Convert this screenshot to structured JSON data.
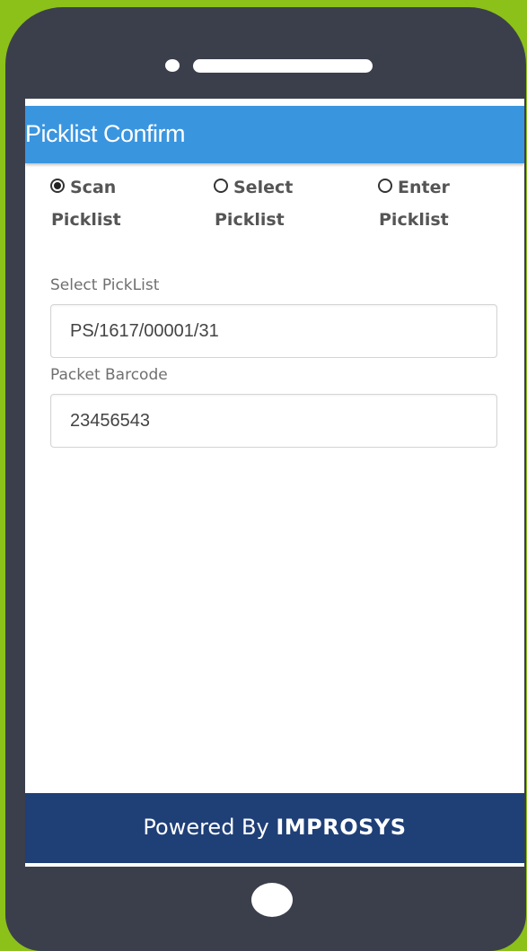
{
  "colors": {
    "background": "#8cc11a",
    "phone_body": "#3b3f4c",
    "title_bar": "#3a95df",
    "footer": "#1f3f77"
  },
  "header": {
    "title": "Picklist Confirm"
  },
  "mode_selector": {
    "selected": "scan",
    "options": [
      {
        "id": "scan",
        "line1": "Scan",
        "line2": "Picklist",
        "checked": true
      },
      {
        "id": "select",
        "line1": "Select",
        "line2": "Picklist",
        "checked": false
      },
      {
        "id": "enter",
        "line1": "Enter",
        "line2": "Picklist",
        "checked": false
      }
    ]
  },
  "form": {
    "picklist": {
      "label": "Select PickList",
      "value": "PS/1617/00001/31"
    },
    "barcode": {
      "label": "Packet Barcode",
      "value": "23456543"
    }
  },
  "footer": {
    "prefix": "Powered By ",
    "brand": "IMPROSYS"
  },
  "icons": {
    "camera": "camera-dot-icon",
    "speaker": "speaker-grille-icon",
    "home": "home-button-icon",
    "radio": "radio-button-icon"
  }
}
